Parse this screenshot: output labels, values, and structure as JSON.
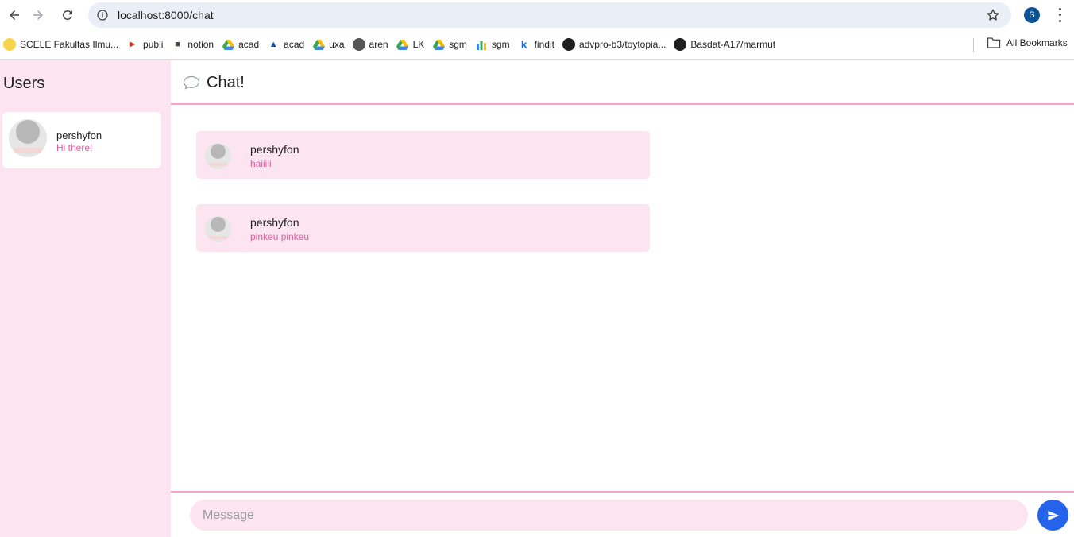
{
  "browser": {
    "url": "localhost:8000/chat",
    "profile_initial": "S",
    "bookmarks": [
      {
        "label": "SCELE Fakultas Ilmu...",
        "icon": "scele-icon"
      },
      {
        "label": "publi",
        "icon": "megaphone-icon"
      },
      {
        "label": "notion",
        "icon": "notion-icon"
      },
      {
        "label": "acad",
        "icon": "google-drive-icon"
      },
      {
        "label": "acad",
        "icon": "graduation-cap-icon"
      },
      {
        "label": "uxa",
        "icon": "google-drive-icon"
      },
      {
        "label": "aren",
        "icon": "globe-icon"
      },
      {
        "label": "LK",
        "icon": "google-drive-icon"
      },
      {
        "label": "sgm",
        "icon": "google-drive-icon"
      },
      {
        "label": "sgm",
        "icon": "chart-icon"
      },
      {
        "label": "findit",
        "icon": "k-icon"
      },
      {
        "label": "advpro-b3/toytopia...",
        "icon": "github-icon"
      },
      {
        "label": "Basdat-A17/marmut",
        "icon": "github-icon"
      }
    ],
    "all_bookmarks_label": "All Bookmarks"
  },
  "sidebar": {
    "title": "Users",
    "users": [
      {
        "name": "pershyfon",
        "preview": "Hi there!"
      }
    ]
  },
  "chat": {
    "title": "Chat!",
    "messages": [
      {
        "sender": "pershyfon",
        "text": "haiiiii"
      },
      {
        "sender": "pershyfon",
        "text": "pinkeu pinkeu"
      }
    ]
  },
  "composer": {
    "placeholder": "Message",
    "value": ""
  },
  "colors": {
    "accent_pink": "#fce4f0",
    "border_pink": "#f2a6c8",
    "text_pink": "#e0609f",
    "send_blue": "#2563eb"
  }
}
